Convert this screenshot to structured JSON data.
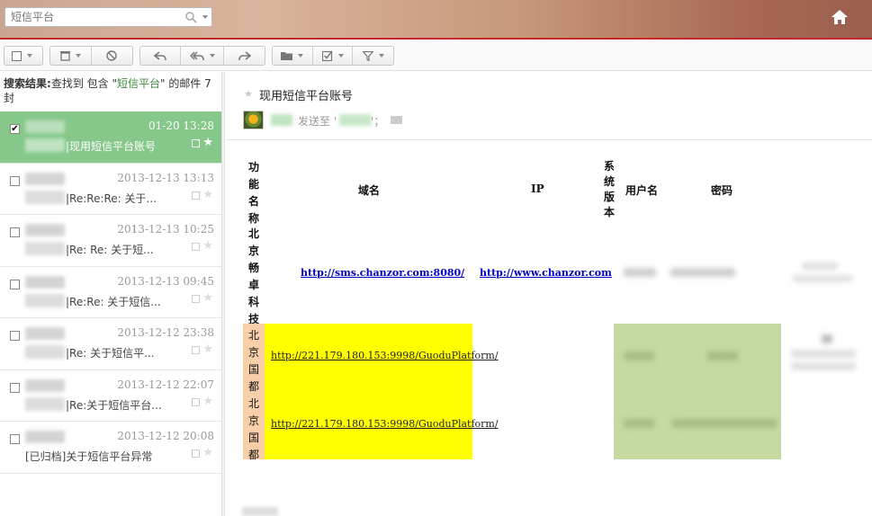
{
  "search": {
    "placeholder": "短信平台"
  },
  "toolbar": {
    "groups": [
      "select",
      "delete-block",
      "reply-group",
      "move-group"
    ]
  },
  "results": {
    "prefix": "搜索结果:",
    "text_before": "查找到 包含 \"",
    "keyword": "短信平台",
    "text_after": "\" 的邮件 7",
    "unit": "封"
  },
  "mails": [
    {
      "time": "01-20 13:28",
      "subject": "|现用短信平台账号",
      "selected": true,
      "checked": "✔"
    },
    {
      "time": "2013-12-13 13:13",
      "subject": "|Re:Re:Re: 关于..."
    },
    {
      "time": "2013-12-13 10:25",
      "subject": "|Re: Re: 关于短...",
      "attachment": true
    },
    {
      "time": "2013-12-13 09:45",
      "subject": "|Re:Re: 关于短信..."
    },
    {
      "time": "2013-12-12 23:38",
      "subject": "|Re: 关于短信平..."
    },
    {
      "time": "2013-12-12 22:07",
      "subject": "|Re:关于短信平台..."
    },
    {
      "time": "2013-12-12 20:08",
      "subject": "[已归档]关于短信平台异常",
      "full": true
    }
  ],
  "reader": {
    "title": "现用短信平台账号",
    "sent_to": "发送至 '",
    "sent_to_end": "'；",
    "table": {
      "headers": {
        "func": "功能名称",
        "domain": "域名",
        "ip": "IP",
        "sysver": "系统版本",
        "user": "用户名",
        "pwd": "密码"
      },
      "rows": [
        {
          "name": "北京畅卓科技",
          "domain": "http://sms.chanzor.com:8080/",
          "ip": "http://www.chanzor.com"
        },
        {
          "name": "北京国都",
          "domain": "http://221.179.180.153:9998/GuoduPlatform/"
        },
        {
          "name": "北京国都",
          "domain": "http://221.179.180.153:9998/GuoduPlatform/"
        }
      ]
    }
  }
}
